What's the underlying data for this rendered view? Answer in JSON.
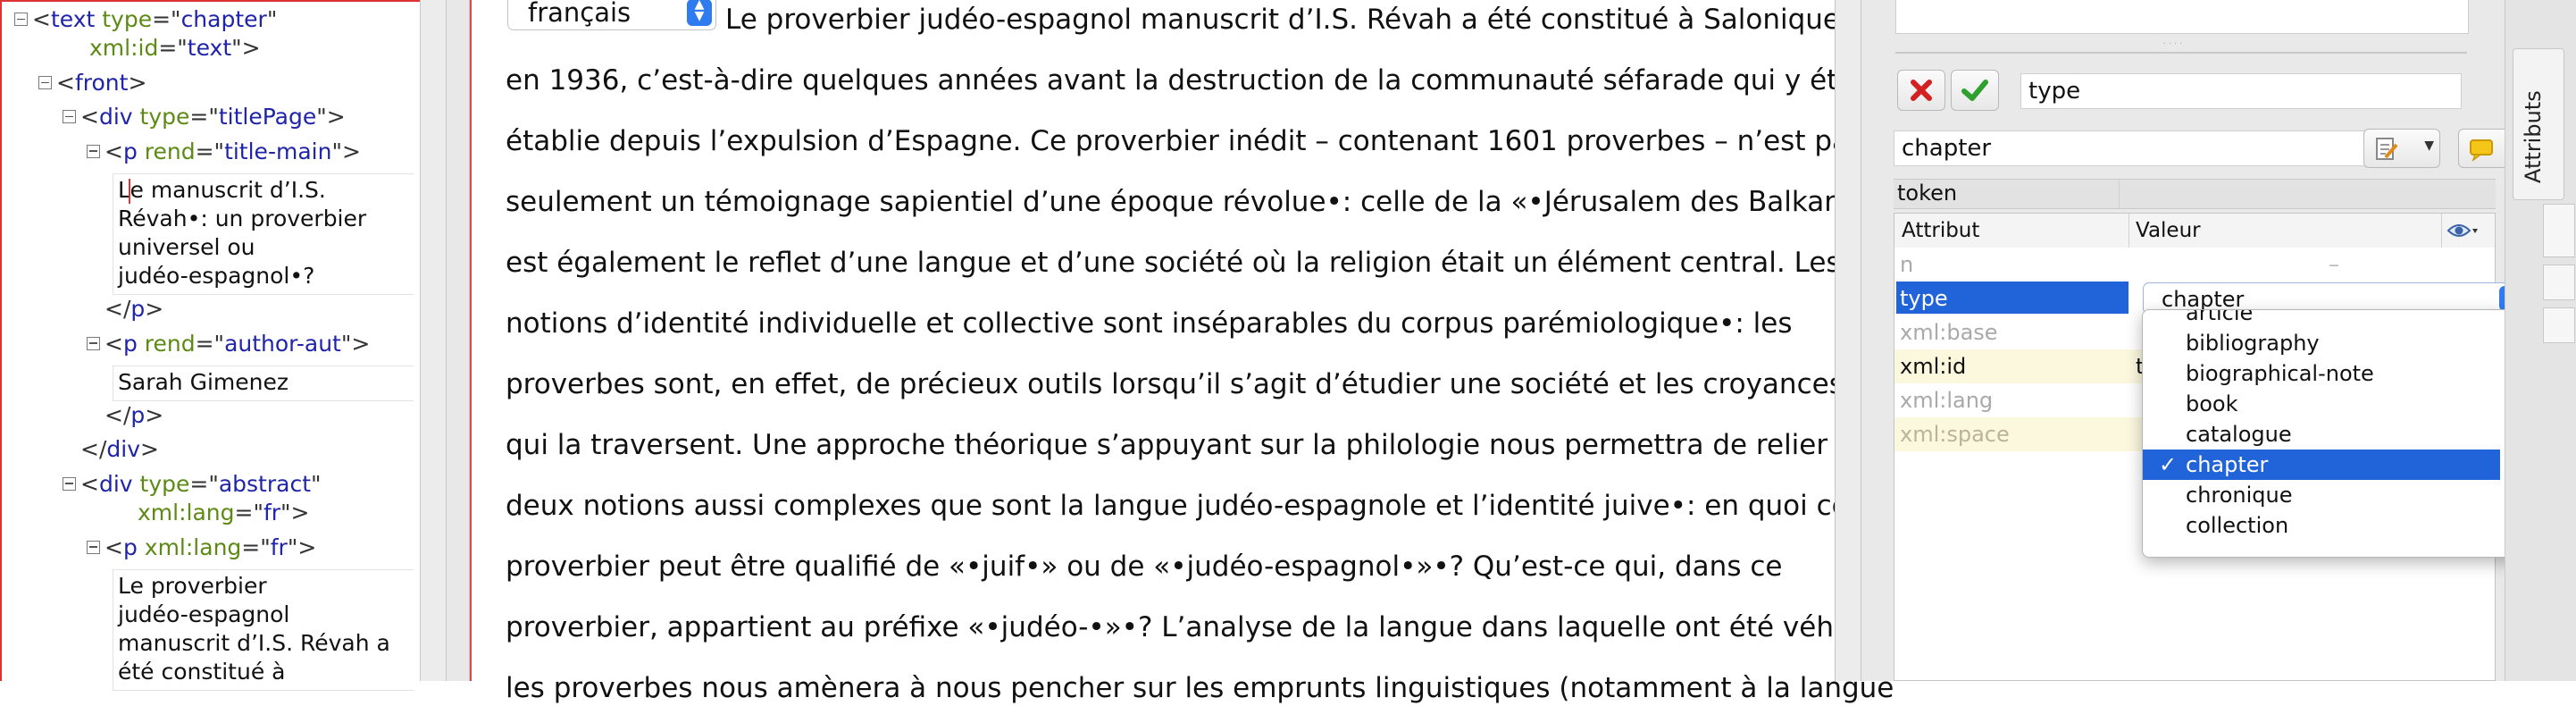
{
  "tree": {
    "nodes": [
      {
        "depth": 0,
        "toggle": true,
        "tag": "text",
        "attrs": [
          {
            "name": "type",
            "value": "chapter"
          }
        ],
        "cont": [
          {
            "name": "xml:id",
            "value": "text"
          }
        ],
        "close": false
      },
      {
        "depth": 1,
        "toggle": true,
        "tag": "front",
        "attrs": [],
        "cont": [],
        "close": false
      },
      {
        "depth": 2,
        "toggle": true,
        "tag": "div",
        "attrs": [
          {
            "name": "type",
            "value": "titlePage"
          }
        ],
        "cont": [],
        "close": false
      },
      {
        "depth": 3,
        "toggle": true,
        "tag": "p",
        "attrs": [
          {
            "name": "rend",
            "value": "title-main"
          }
        ],
        "cont": [],
        "close": false
      },
      {
        "depth": 4,
        "text": [
          "Le manuscrit d’I.S.",
          "Révah•: un proverbier",
          "universel ou",
          "judéo-espagnol•?"
        ]
      },
      {
        "depth": 3,
        "toggle": false,
        "tag": "p",
        "attrs": [],
        "cont": [],
        "close": true
      },
      {
        "depth": 3,
        "toggle": true,
        "tag": "p",
        "attrs": [
          {
            "name": "rend",
            "value": "author-aut"
          }
        ],
        "cont": [],
        "close": false
      },
      {
        "depth": 4,
        "text": [
          "Sarah Gimenez"
        ]
      },
      {
        "depth": 3,
        "toggle": false,
        "tag": "p",
        "attrs": [],
        "cont": [],
        "close": true
      },
      {
        "depth": 2,
        "toggle": false,
        "tag": "div",
        "attrs": [],
        "cont": [],
        "close": true
      },
      {
        "depth": 2,
        "toggle": true,
        "tag": "div",
        "attrs": [
          {
            "name": "type",
            "value": "abstract"
          }
        ],
        "cont": [
          {
            "name": "xml:lang",
            "value": "fr"
          }
        ],
        "close": false
      },
      {
        "depth": 3,
        "toggle": true,
        "tag": "p",
        "attrs": [
          {
            "name": "xml:lang",
            "value": "fr"
          }
        ],
        "cont": [],
        "close": false
      },
      {
        "depth": 4,
        "text": [
          "Le proverbier",
          "judéo-espagnol",
          "manuscrit d’I.S. Révah a",
          "été constitué à"
        ]
      }
    ]
  },
  "editor": {
    "language_select": {
      "value": "français"
    },
    "lines": [
      "Le proverbier judéo-espagnol manuscrit d’I.S. Révah a été constitué à Salonique",
      "en 1936, c’est-à-dire quelques années avant la destruction de la communauté séfarade qui y était",
      "établie depuis l’expulsion d’Espagne. Ce proverbier inédit – contenant 1601 proverbes – n’est pas",
      "seulement un témoignage sapientiel d’une époque révolue•: celle de la «•Jérusalem des Balkans•», il",
      "est également le reflet d’une langue et d’une société où la religion était un élément central. Les",
      "notions d’identité individuelle et collective sont inséparables du corpus parémiologique•: les",
      "proverbes sont, en effet, de précieux outils lorsqu’il s’agit d’étudier une société et les croyances",
      "qui la traversent. Une approche théorique s’appuyant sur la philologie nous permettra de relier",
      "deux notions aussi complexes que sont la langue judéo-espagnole et l’identité juive•: en quoi ce",
      "proverbier peut être qualifié de «•juif•» ou de «•judéo-espagnol•»•? Qu’est-ce qui, dans ce",
      "proverbier, appartient au préfixe «•judéo-•»•? L’analyse de la langue dans laquelle ont été véhiculés",
      "les proverbes nous amènera à nous pencher sur les emprunts linguistiques (notamment à la langue"
    ]
  },
  "panel": {
    "name_value": "type",
    "value_field": "chapter",
    "token_label": "token",
    "header_attribute": "Attribut",
    "header_value": "Valeur",
    "rows": [
      {
        "name": "n",
        "value": "–",
        "state": "dim"
      },
      {
        "name": "type",
        "value": "chapter",
        "state": "selected"
      },
      {
        "name": "xml:base",
        "value": "",
        "state": "dim"
      },
      {
        "name": "xml:id",
        "value": "text",
        "state": "yellow"
      },
      {
        "name": "xml:lang",
        "value": "",
        "state": "dim"
      },
      {
        "name": "xml:space",
        "value": "",
        "state": "yellowdim"
      }
    ],
    "side_tab": "Attributs"
  },
  "dropdown": {
    "selected": "chapter",
    "options": [
      "article",
      "bibliography",
      "biographical-note",
      "book",
      "catalogue",
      "chapter",
      "chronique",
      "collection"
    ]
  },
  "colors": {
    "accent": "#2163d9",
    "tag": "#1f24a8",
    "attr_name": "#5c8a14",
    "cancel": "#d32020",
    "ok": "#2fa02f"
  }
}
